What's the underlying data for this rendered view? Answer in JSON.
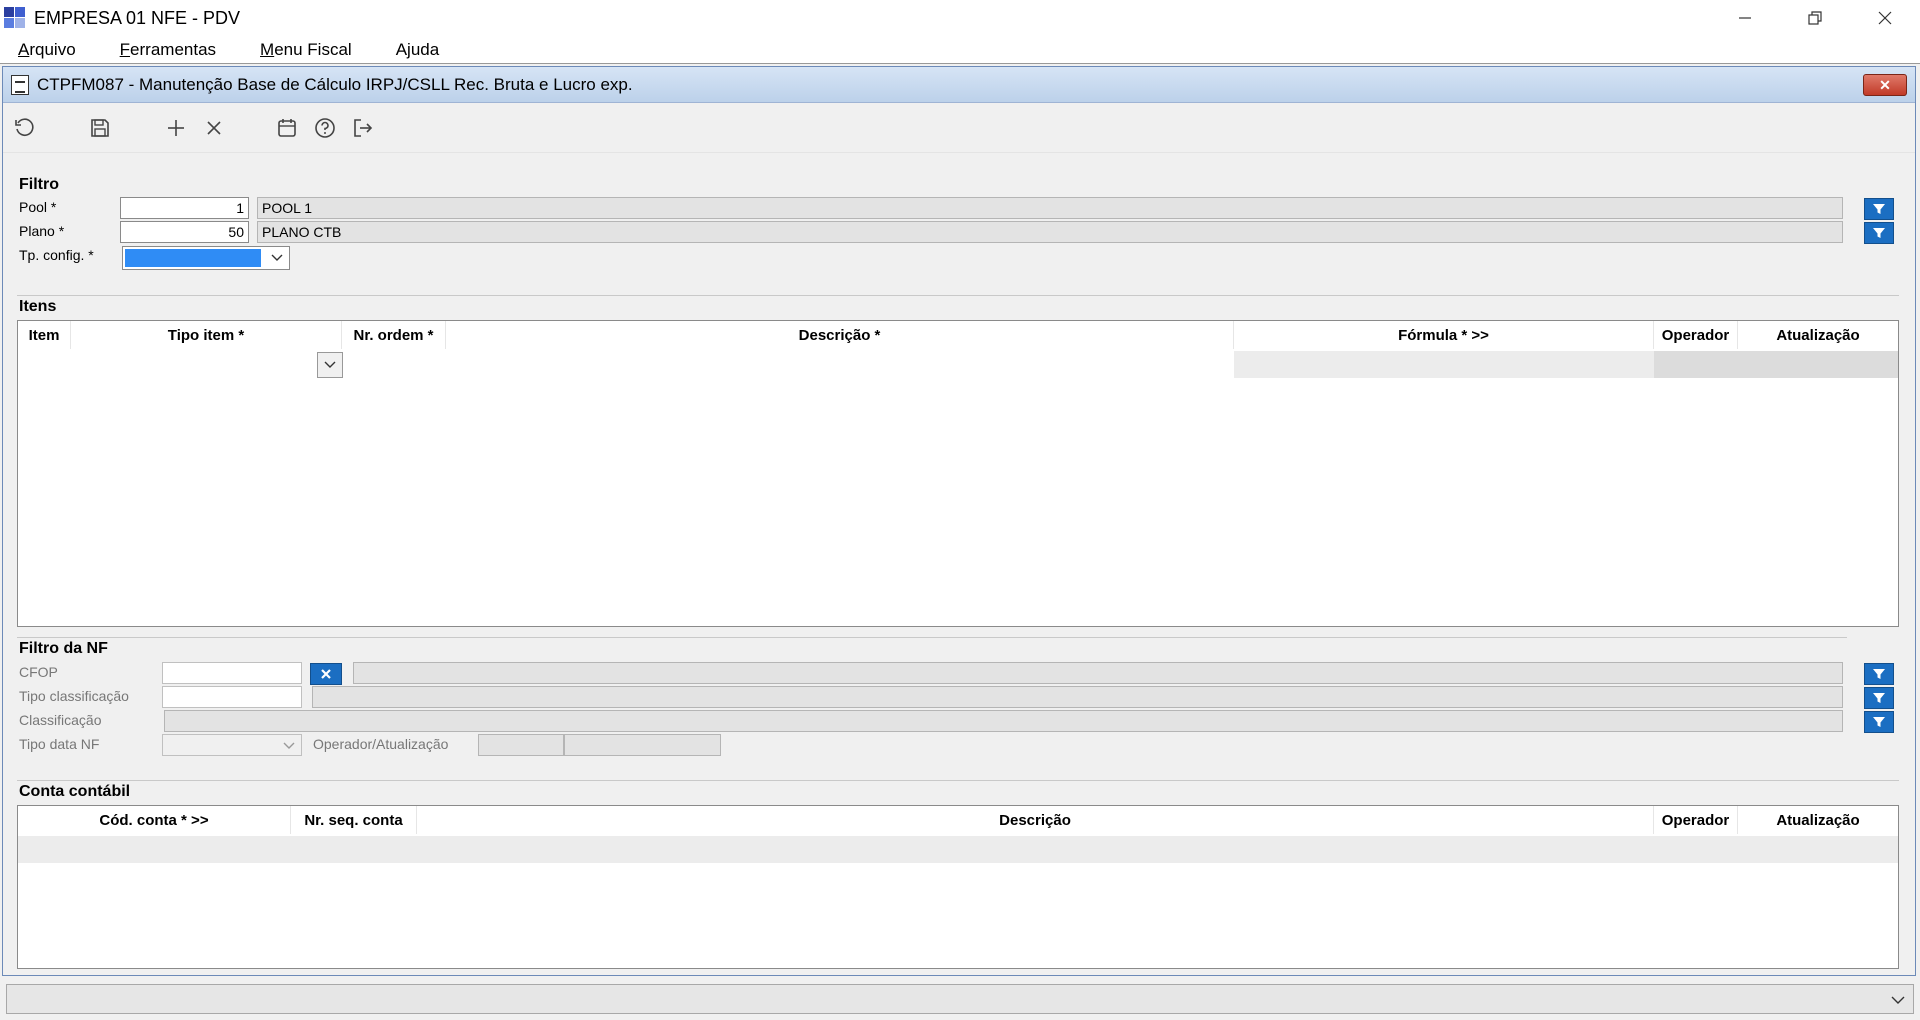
{
  "app": {
    "title": "EMPRESA 01 NFE - PDV",
    "window_controls": [
      "minimize-icon",
      "restore-icon",
      "close-icon"
    ]
  },
  "menu": {
    "items": [
      {
        "label": "Arquivo",
        "mnemonic": "A"
      },
      {
        "label": "Ferramentas",
        "mnemonic": "F"
      },
      {
        "label": "Menu Fiscal",
        "mnemonic": "M"
      },
      {
        "label": "Ajuda",
        "mnemonic": "j"
      }
    ]
  },
  "form": {
    "title": "CTPFM087 - Manutenção Base de Cálculo IRPJ/CSLL Rec. Bruta e Lucro exp.",
    "toolbar": [
      "undo-icon",
      "save-icon",
      "add-icon",
      "delete-icon",
      "calendar-icon",
      "help-icon",
      "exit-icon"
    ]
  },
  "filtro": {
    "title": "Filtro",
    "pool": {
      "label": "Pool *",
      "value": "1",
      "desc": "POOL 1"
    },
    "plano": {
      "label": "Plano *",
      "value": "50",
      "desc": "PLANO CTB"
    },
    "tp_config": {
      "label": "Tp. config. *",
      "value": ""
    }
  },
  "itens": {
    "title": "Itens",
    "columns": [
      "Item",
      "Tipo item *",
      "Nr. ordem *",
      "Descrição *",
      "Fórmula * >>",
      "Operador",
      "Atualização"
    ]
  },
  "filtro_nf": {
    "title": "Filtro da NF",
    "cfop": {
      "label": "CFOP",
      "value": ""
    },
    "tipo_classificacao": {
      "label": "Tipo classificação",
      "value": ""
    },
    "classificacao": {
      "label": "Classificação",
      "value": ""
    },
    "tipo_data_nf": {
      "label": "Tipo data NF",
      "value": ""
    },
    "operador_atualizacao": {
      "label": "Operador/Atualização"
    }
  },
  "conta": {
    "title": "Conta contábil",
    "columns": [
      "Cód. conta * >>",
      "Nr. seq. conta",
      "Descrição",
      "Operador",
      "Atualização"
    ]
  },
  "colors": {
    "accent": "#1b6ec2",
    "selection": "#2f8cf5",
    "close": "#c13a28"
  }
}
